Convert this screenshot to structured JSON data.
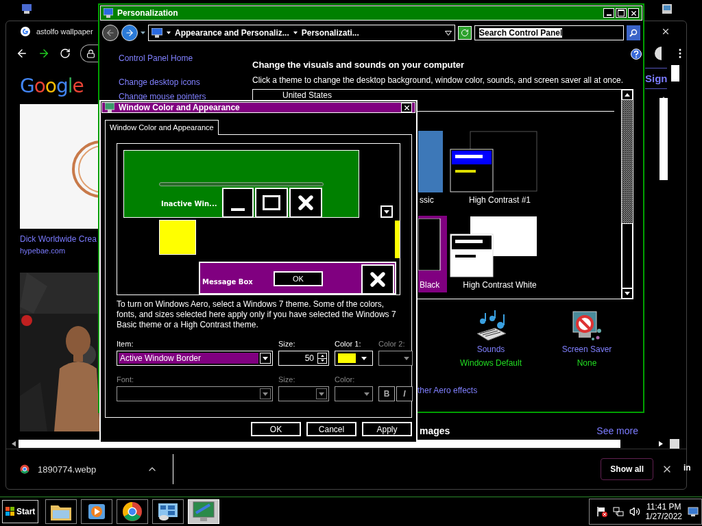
{
  "browser": {
    "tab_title": "astolfo wallpaper",
    "logo": "Google",
    "results": [
      {
        "title": "Dick Worldwide Crea",
        "site": "hypebae.com"
      }
    ],
    "sign_in": "Sign",
    "section_title": "mages",
    "see_more": "See more",
    "download": {
      "file": "1890774.webp"
    },
    "show_all": "Show all"
  },
  "edge_text": "in",
  "personalization": {
    "title": "Personalization",
    "breadcrumbs": [
      "Appearance and Personaliz...",
      "Personalizati..."
    ],
    "search": {
      "placeholder": "Search Control Panel"
    },
    "nav_links": [
      "Control Panel Home",
      "Change desktop icons",
      "Change mouse pointers"
    ],
    "heading": "Change the visuals and sounds on your computer",
    "subtitle": "Click a theme to change the desktop background, window color, sounds, and screen saver all at once.",
    "theme_group": "United States",
    "themes": [
      {
        "label": "ssic",
        "kind": "classic",
        "selected": false
      },
      {
        "label": "High Contrast #1",
        "kind": "contrast1",
        "selected": false
      },
      {
        "label": "Black",
        "kind": "black",
        "selected": true
      },
      {
        "label": "High Contrast White",
        "kind": "white",
        "selected": false
      }
    ],
    "settings": [
      {
        "kind": "sounds",
        "label": "Sounds",
        "value": "Windows Default"
      },
      {
        "kind": "screensaver",
        "label": "Screen Saver",
        "value": "None"
      }
    ],
    "aero_link": "ther Aero effects"
  },
  "dialog": {
    "title": "Window Color and Appearance",
    "tabs": [
      {
        "label": "Window Color and Appearance",
        "selected": true
      }
    ],
    "preview": {
      "inactive_title": "Inactive Win...",
      "message_title": "Message Box",
      "ok": "OK"
    },
    "note": "To turn on Windows Aero, select a Windows 7 theme.  Some of the colors, fonts, and sizes selected here apply only if you have selected the Windows 7 Basic theme or a High Contrast theme.",
    "item": {
      "label": "Item:",
      "value": "Active Window Border",
      "disabled": false
    },
    "size": {
      "label": "Size:",
      "value": "50",
      "disabled": false
    },
    "color1": {
      "label": "Color 1:",
      "color": "#ffff00",
      "disabled": false
    },
    "color2": {
      "label": "Color 2:",
      "disabled": true
    },
    "font": {
      "label": "Font:",
      "disabled": true
    },
    "font_size": {
      "label": "Size:",
      "disabled": true
    },
    "font_color": {
      "label": "Color:",
      "disabled": true
    },
    "bold": {
      "label": "B",
      "disabled": true
    },
    "italic": {
      "label": "I",
      "disabled": true
    },
    "buttons": [
      "OK",
      "Cancel",
      "Apply"
    ]
  },
  "taskbar": {
    "start": "Start",
    "apps": [
      {
        "kind": "explorer",
        "selected": false
      },
      {
        "kind": "media",
        "selected": false
      },
      {
        "kind": "chrome",
        "selected": false
      },
      {
        "kind": "control",
        "selected": false
      },
      {
        "kind": "personalize",
        "selected": true
      }
    ],
    "time": "11:41 PM",
    "date": "1/27/2022"
  }
}
